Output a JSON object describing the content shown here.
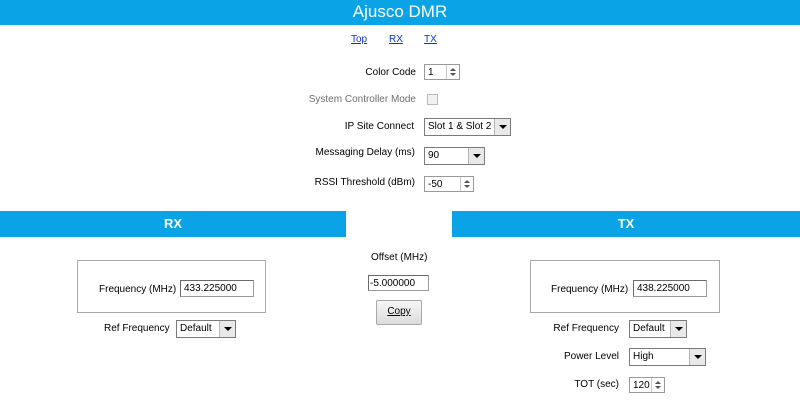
{
  "title": "Ajusco DMR",
  "nav": {
    "top": "Top",
    "rx": "RX",
    "tx": "TX"
  },
  "settings": {
    "color_code": {
      "label": "Color Code",
      "value": "1"
    },
    "system_controller_mode": {
      "label": "System Controller Mode",
      "checked": false
    },
    "ip_site_connect": {
      "label": "IP Site Connect",
      "value": "Slot 1 & Slot 2"
    },
    "messaging_delay": {
      "label": "Messaging Delay (ms)",
      "value": "90"
    },
    "rssi_threshold": {
      "label": "RSSI Threshold (dBm)",
      "value": "-50"
    }
  },
  "rx": {
    "heading": "RX",
    "frequency": {
      "label": "Frequency (MHz)",
      "value": "433.225000"
    },
    "ref_frequency": {
      "label": "Ref Frequency",
      "value": "Default"
    }
  },
  "offset": {
    "label": "Offset (MHz)",
    "value": "-5.000000",
    "copy_label": "Copy"
  },
  "tx": {
    "heading": "TX",
    "frequency": {
      "label": "Frequency (MHz)",
      "value": "438.225000"
    },
    "ref_frequency": {
      "label": "Ref Frequency",
      "value": "Default"
    },
    "power_level": {
      "label": "Power Level",
      "value": "High"
    },
    "tot": {
      "label": "TOT (sec)",
      "value": "120"
    }
  },
  "colors": {
    "accent": "#0aa3e6",
    "link": "#0b33d6"
  }
}
